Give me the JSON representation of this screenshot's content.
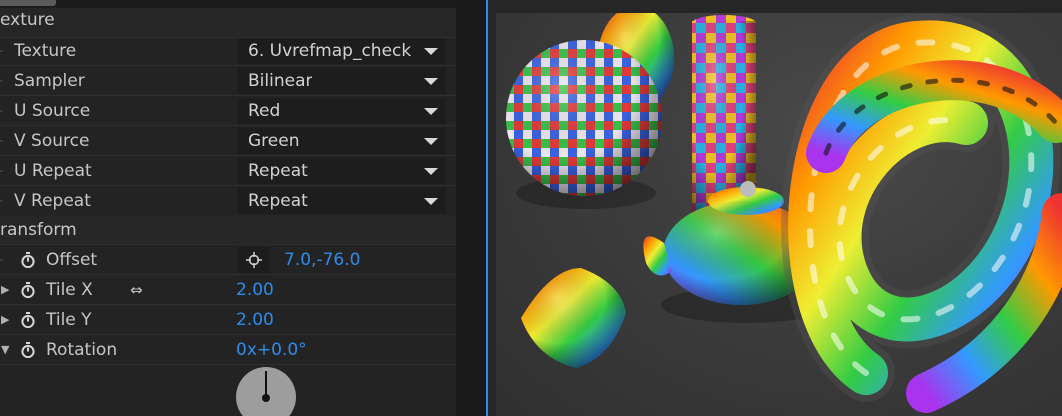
{
  "tabstrip": {
    "active_tab": ""
  },
  "groups": {
    "texture": "exture",
    "transform": "ransform"
  },
  "properties": {
    "texture": {
      "label": "Texture",
      "value": "6. Uvrefmap_check"
    },
    "sampler": {
      "label": "Sampler",
      "value": "Bilinear"
    },
    "u_source": {
      "label": "U Source",
      "value": "Red"
    },
    "v_source": {
      "label": "V Source",
      "value": "Green"
    },
    "u_repeat": {
      "label": "U Repeat",
      "value": "Repeat"
    },
    "v_repeat": {
      "label": "V Repeat",
      "value": "Repeat"
    },
    "offset": {
      "label": "Offset",
      "value": "7.0,-76.0"
    },
    "tile_x": {
      "label": "Tile X",
      "value": "2.00"
    },
    "tile_y": {
      "label": "Tile Y",
      "value": "2.00"
    },
    "rotation": {
      "label": "Rotation",
      "value": "0x+0.0°"
    }
  },
  "icons": {
    "dropdown": "chevron-down-icon",
    "stopwatch": "stopwatch-icon",
    "target": "crosshair-icon",
    "resize_cursor": "resize-horizontal-cursor-icon",
    "twirl_open": "▼",
    "twirl_closed": "▶"
  },
  "colors": {
    "accent": "#2d8ceb",
    "panel_bg": "#232323",
    "field_bg": "#1d1d1d"
  },
  "viewer": {
    "objects": [
      "checker-sphere",
      "checker-cylinder",
      "checker-teapot",
      "checker-pillow",
      "rainbow-torus-knot",
      "striped-egg"
    ]
  }
}
